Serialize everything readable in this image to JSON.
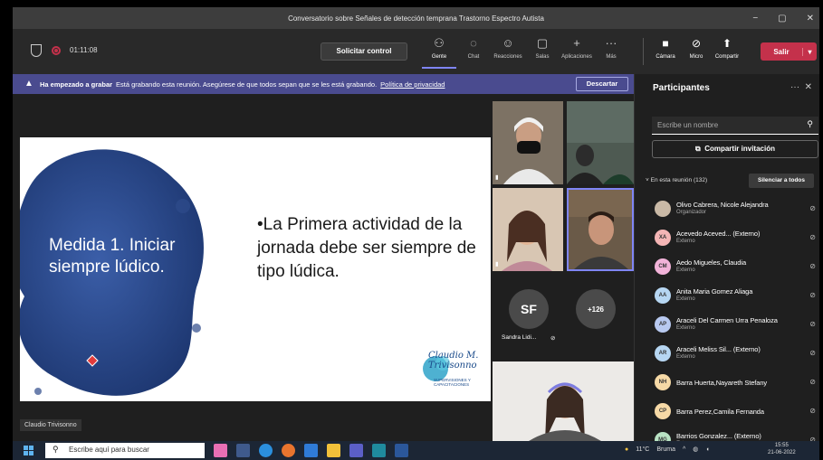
{
  "window": {
    "title": "Conversatorio sobre Señales de detección temprana Trastorno Espectro Autista",
    "controls": [
      "−",
      "▢",
      "✕"
    ]
  },
  "toolbar": {
    "timer": "01:11:08",
    "request_control": "Solicitar control",
    "tools": [
      {
        "icon": "people-icon",
        "glyph": "⚇",
        "label": "Gente"
      },
      {
        "icon": "chat-icon",
        "glyph": "◌",
        "label": "Chat"
      },
      {
        "icon": "reactions-icon",
        "glyph": "☺",
        "label": "Reacciones"
      },
      {
        "icon": "rooms-icon",
        "glyph": "▢",
        "label": "Salas"
      },
      {
        "icon": "apps-icon",
        "glyph": "+",
        "label": "Aplicaciones"
      },
      {
        "icon": "more-icon",
        "glyph": "···",
        "label": "Más"
      }
    ],
    "media": [
      {
        "icon": "camera-icon",
        "glyph": "■",
        "label": "Cámara"
      },
      {
        "icon": "mic-off-icon",
        "glyph": "⊘",
        "label": "Micro"
      },
      {
        "icon": "share-icon",
        "glyph": "⬆",
        "label": "Compartir"
      }
    ],
    "leave": "Salir"
  },
  "banner": {
    "bold": "Ha empezado a grabar",
    "text": "Está grabando esta reunión. Asegúrese de que todos sepan que se les está grabando.",
    "link": "Política de privacidad",
    "dismiss": "Descartar"
  },
  "slide": {
    "title": "Medida 1. Iniciar siempre lúdico.",
    "bullet": "•La Primera actividad de la jornada debe ser siempre de tipo lúdica.",
    "logo_signature": "Claudio M. Trivisonno",
    "logo_sub": "SUPERVISIONES Y CAPACITACIONES"
  },
  "presenter_name": "Claudio Trivisonno",
  "video": {
    "sf_initials": "SF",
    "sf_name": "Sandra Lidi...",
    "overflow": "+126"
  },
  "panel": {
    "title": "Participantes",
    "search_placeholder": "Escribe un nombre",
    "invite": "Compartir invitación",
    "in_meeting": "En esta reunión (132)",
    "mute_all": "Silenciar a todos",
    "participants": [
      {
        "initials": "",
        "name": "Olivo Cabrera, Nicole Alejandra",
        "role": "Organizador",
        "color": "#c9b9a6"
      },
      {
        "initials": "XA",
        "name": "Acevedo Aceved... (Externo)",
        "role": "Externo",
        "color": "#f4b5b5"
      },
      {
        "initials": "CM",
        "name": "Aedo Migueles, Claudia",
        "role": "Externo",
        "color": "#f2b3d9"
      },
      {
        "initials": "AA",
        "name": "Anita Maria Gomez Aliaga",
        "role": "Externo",
        "color": "#b6d6f2"
      },
      {
        "initials": "AP",
        "name": "Araceli Del Carmen Urra Penaloza",
        "role": "Externo",
        "color": "#b8c9f0"
      },
      {
        "initials": "AR",
        "name": "Araceli Meliss Sil... (Externo)",
        "role": "Externo",
        "color": "#b6d6f2"
      },
      {
        "initials": "NH",
        "name": "Barra Huerta,Nayareth Stefany",
        "role": "",
        "color": "#f6d9a6"
      },
      {
        "initials": "CP",
        "name": "Barra Perez,Camila Fernanda",
        "role": "",
        "color": "#f6d9a6"
      },
      {
        "initials": "MG",
        "name": "Barrios Gonzalez... (Externo)",
        "role": "Externo",
        "color": "#b9e3c4"
      }
    ]
  },
  "taskbar": {
    "search": "Escribe aquí para buscar",
    "weather": "11°C",
    "location": "Bruma",
    "time": "15:55",
    "date": "21-06-2022"
  }
}
